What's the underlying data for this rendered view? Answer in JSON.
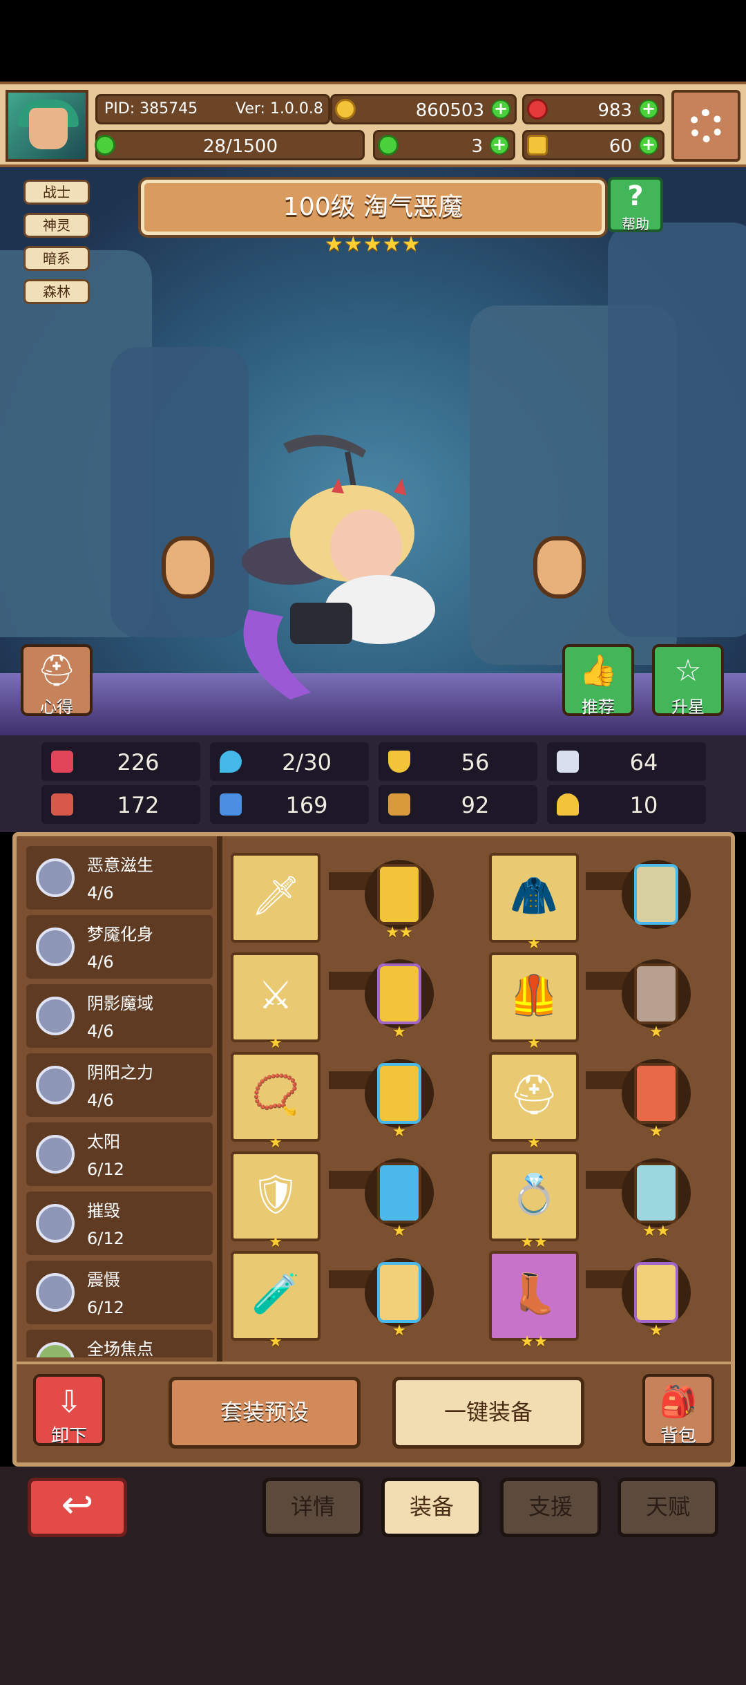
{
  "player": {
    "pid": "PID: 385745",
    "version": "Ver: 1.0.0.8",
    "gold": "860503",
    "gems": "983",
    "energy": "28/1500",
    "clover": "3",
    "scroll": "60"
  },
  "hero": {
    "tags": [
      "战士",
      "神灵",
      "暗系",
      "森林"
    ],
    "title": "100级 淘气恶魔",
    "stars": "★★★★★",
    "help_label": "帮助",
    "insight_label": "心得",
    "recommend_label": "推荐",
    "star_up_label": "升星"
  },
  "stats": [
    {
      "icon": "heart-icon",
      "value": "226",
      "color": "#e0455a"
    },
    {
      "icon": "water-drop-icon",
      "value": "2/30",
      "color": "#44b8e8"
    },
    {
      "icon": "shield-icon",
      "value": "56",
      "color": "#f2c43a"
    },
    {
      "icon": "wing-icon",
      "value": "64",
      "color": "#d8e0f0"
    },
    {
      "icon": "fist-icon",
      "value": "172",
      "color": "#d8584a"
    },
    {
      "icon": "book-icon",
      "value": "169",
      "color": "#4a8fe0"
    },
    {
      "icon": "tome-icon",
      "value": "92",
      "color": "#d89a3a"
    },
    {
      "icon": "horseshoe-icon",
      "value": "10",
      "color": "#f2c43a"
    }
  ],
  "sets": [
    {
      "name": "恶意滋生",
      "count": "4/6"
    },
    {
      "name": "梦魇化身",
      "count": "4/6"
    },
    {
      "name": "阴影魔域",
      "count": "4/6"
    },
    {
      "name": "阴阳之力",
      "count": "4/6"
    },
    {
      "name": "太阳",
      "count": "6/12"
    },
    {
      "name": "摧毁",
      "count": "6/12"
    },
    {
      "name": "震慑",
      "count": "6/12"
    },
    {
      "name": "全场焦点",
      "count": ""
    }
  ],
  "equipment": {
    "left": [
      {
        "name": "sword-icon",
        "stars": "★★",
        "rune_stars": "★★"
      },
      {
        "name": "spear-icon",
        "stars": "★",
        "rune_stars": "★"
      },
      {
        "name": "necklace-icon",
        "stars": "★",
        "rune_stars": "★"
      },
      {
        "name": "shoulder-armor-icon",
        "stars": "★",
        "rune_stars": "★"
      },
      {
        "name": "potion-icon",
        "stars": "★",
        "rune_stars": "★"
      }
    ],
    "right": [
      {
        "name": "hood-icon",
        "stars": "★",
        "rune_stars": ""
      },
      {
        "name": "armor-icon",
        "stars": "★",
        "rune_stars": "★"
      },
      {
        "name": "helmet-icon",
        "stars": "★",
        "rune_stars": "★"
      },
      {
        "name": "ring-icon",
        "stars": "★★",
        "rune_stars": "★★"
      },
      {
        "name": "boots-icon",
        "stars": "★★",
        "rune_stars": "★"
      }
    ]
  },
  "actions": {
    "unequip": "卸下",
    "preset": "套装预设",
    "equip_all": "一键装备",
    "backpack": "背包"
  },
  "tabs": [
    "详情",
    "装备",
    "支援",
    "天赋"
  ],
  "active_tab": 1,
  "colors": {
    "accent": "#d28a5a",
    "panel": "#7b5031"
  }
}
